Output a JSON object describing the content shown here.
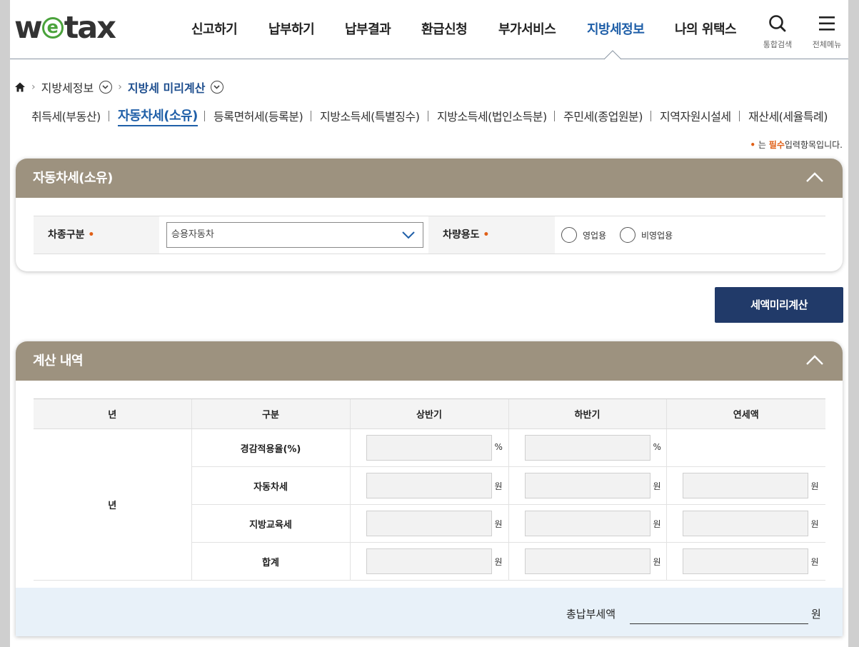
{
  "header": {
    "logo": {
      "pre": "w",
      "mid": "e",
      "post": "tax"
    },
    "nav": [
      "신고하기",
      "납부하기",
      "납부결과",
      "환급신청",
      "부가서비스",
      "지방세정보",
      "나의 위택스"
    ],
    "active_nav": "지방세정보",
    "search_label": "통합검색",
    "menu_label": "전체메뉴"
  },
  "breadcrumb": {
    "level1": "지방세정보",
    "level2": "지방세 미리계산"
  },
  "subtabs": [
    "취득세(부동산)",
    "자동차세(소유)",
    "등록면허세(등록분)",
    "지방소득세(특별징수)",
    "지방소득세(법인소득분)",
    "주민세(종업원분)",
    "지역자원시설세",
    "재산세(세율특례)"
  ],
  "active_subtab": "자동차세(소유)",
  "required_note": {
    "dot": "•",
    "pre": "는",
    "bold": "필수",
    "post": "입력항목입니다."
  },
  "form_panel": {
    "title": "자동차세(소유)",
    "vehicle_type_label": "차종구분",
    "vehicle_type_value": "승용자동차",
    "vehicle_use_label": "차량용도",
    "radio_business": "영업용",
    "radio_nonbusiness": "비영업용",
    "req_marker": "•"
  },
  "calc_button": "세액미리계산",
  "result_panel": {
    "title": "계산 내역",
    "columns": [
      "년",
      "구분",
      "상반기",
      "하반기",
      "연세액"
    ],
    "year_cell": "년",
    "rows": [
      {
        "label": "경감적용율(%)",
        "unit": "%"
      },
      {
        "label": "자동차세",
        "unit": "원"
      },
      {
        "label": "지방교육세",
        "unit": "원"
      },
      {
        "label": "합계",
        "unit": "원"
      }
    ],
    "total_label": "총납부세액",
    "total_unit": "원"
  },
  "colors": {
    "panel_header": "#9d927f",
    "button": "#213a69",
    "accent": "#1f5fa8",
    "required": "#e06018",
    "total_bg": "#e8f1f9"
  }
}
